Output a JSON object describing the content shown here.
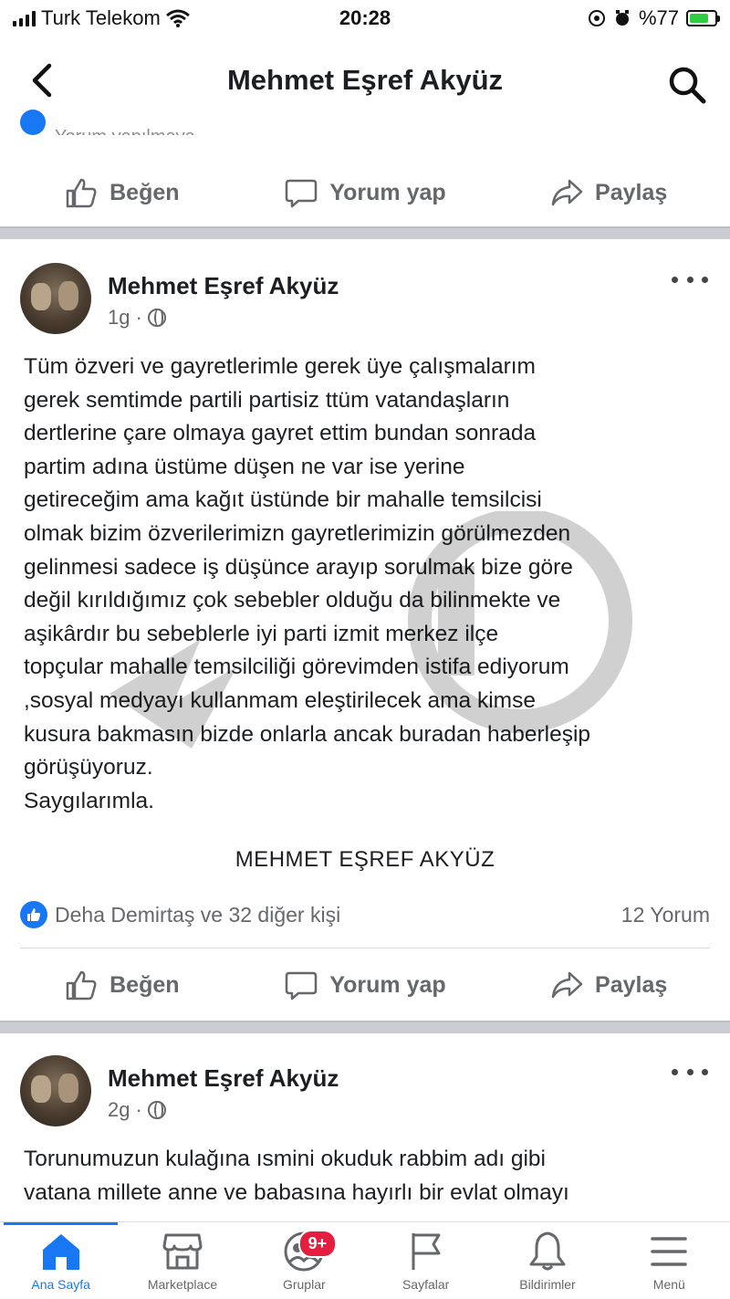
{
  "status_bar": {
    "carrier": "Turk Telekom",
    "time": "20:28",
    "battery": "%77",
    "battery_level": 0.77
  },
  "header": {
    "title": "Mehmet Eşref Akyüz"
  },
  "top_cut_text": "Yorum yapılmaya",
  "actions": {
    "like": "Beğen",
    "comment": "Yorum yap",
    "share": "Paylaş"
  },
  "posts": [
    {
      "author": "Mehmet Eşref Akyüz",
      "time": "1g",
      "body_lines": [
        "Tüm özveri ve gayretlerimle gerek üye  çalışmalarım",
        "gerek semtimde partili partisiz ttüm vatandaşların",
        "dertlerine çare olmaya gayret ettim bundan sonrada",
        "partim adına  üstüme düşen ne var ise yerine",
        "getireceğim ama kağıt üstünde bir mahalle temsilcisi",
        "olmak bizim özverilerimizn gayretlerimizin görülmezden",
        "gelinmesi sadece iş düşünce arayıp sorulmak bize göre",
        "değil kırıldığımız çok sebebler olduğu da bilinmekte ve",
        "aşikârdır  bu sebeblerle iyi parti izmit merkez ilçe",
        "topçular mahalle temsilciliği görevimden istifa ediyorum",
        ",sosyal medyayı kullanmam eleştirilecek ama kimse",
        "kusura bakmasın bizde onlarla ancak buradan haberleşip",
        "görüşüyoruz.",
        "Saygılarımla."
      ],
      "signature": "MEHMET EŞREF AKYÜZ",
      "reactions_text": "Deha Demirtaş ve 32 diğer kişi",
      "comments_count": "12 Yorum"
    },
    {
      "author": "Mehmet Eşref Akyüz",
      "time": "2g",
      "body_lines": [
        "Torunumuzun kulağına ısmini okuduk rabbim adı gibi",
        "vatana millete anne ve babasına hayırlı bir evlat olmayı"
      ]
    }
  ],
  "bottom_nav": {
    "items": [
      {
        "label": "Ana Sayfa",
        "icon": "home-icon"
      },
      {
        "label": "Marketplace",
        "icon": "marketplace-icon"
      },
      {
        "label": "Gruplar",
        "icon": "groups-icon",
        "badge": "9+"
      },
      {
        "label": "Sayfalar",
        "icon": "flag-icon"
      },
      {
        "label": "Bildirimler",
        "icon": "bell-icon"
      },
      {
        "label": "Menü",
        "icon": "menu-icon"
      }
    ]
  },
  "colors": {
    "accent": "#1877f2",
    "badge": "#e41e3f",
    "muted": "#65676b",
    "separator": "#c9ccd1"
  }
}
